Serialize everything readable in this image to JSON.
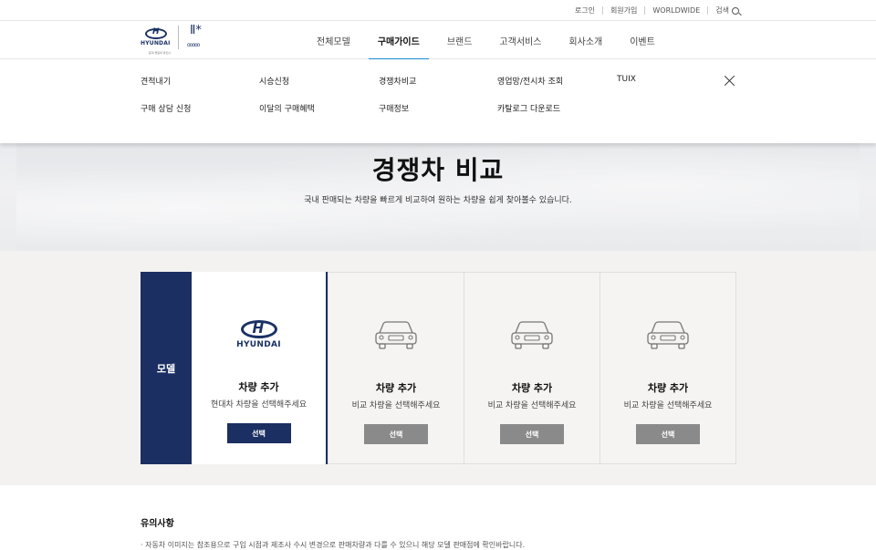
{
  "util": {
    "login": "로그인",
    "signup": "회원가입",
    "worldwide": "WORLDWIDE",
    "search": "검색"
  },
  "header": {
    "brand": "HYUNDAI",
    "tagline": "동계 올림픽 파트너",
    "nav": [
      "전체모델",
      "구매가이드",
      "브랜드",
      "고객서비스",
      "회사소개",
      "이벤트"
    ],
    "active_nav": "구매가이드"
  },
  "submenu": {
    "links": [
      "견적내기",
      "시승신청",
      "경쟁차비교",
      "영업망/전시차 조회",
      "TUIX",
      "구매 상담 신청",
      "이달의 구매혜택",
      "구매정보",
      "카탈로그 다운로드"
    ]
  },
  "hero": {
    "title": "경쟁차 비교",
    "subtitle": "국내 판매되는 차량을 빠르게 비교하여 원하는 차량을 쉽게 찾아볼수 있습니다."
  },
  "compare": {
    "model_label": "모델",
    "cards": [
      {
        "brand": "HYUNDAI",
        "title": "차량 추가",
        "desc": "현대차 차량을 선택해주세요",
        "button": "선택"
      },
      {
        "title": "차량 추가",
        "desc": "비교 차량을 선택해주세요",
        "button": "선택"
      },
      {
        "title": "차량 추가",
        "desc": "비교 차량을 선택해주세요",
        "button": "선택"
      },
      {
        "title": "차량 추가",
        "desc": "비교 차량을 선택해주세요",
        "button": "선택"
      }
    ]
  },
  "notes": {
    "title": "유의사항",
    "line1": "· 자동차 이미지는 참조용으로 구입 시점과 제조사 수시 변경으로 판매차량과 다를 수 있으니 해당 모델 판매점에 확인바랍니다."
  },
  "colors": {
    "navy": "#1b2f62",
    "accent": "#1b8ad6",
    "button_gray": "#8a8a8a"
  }
}
